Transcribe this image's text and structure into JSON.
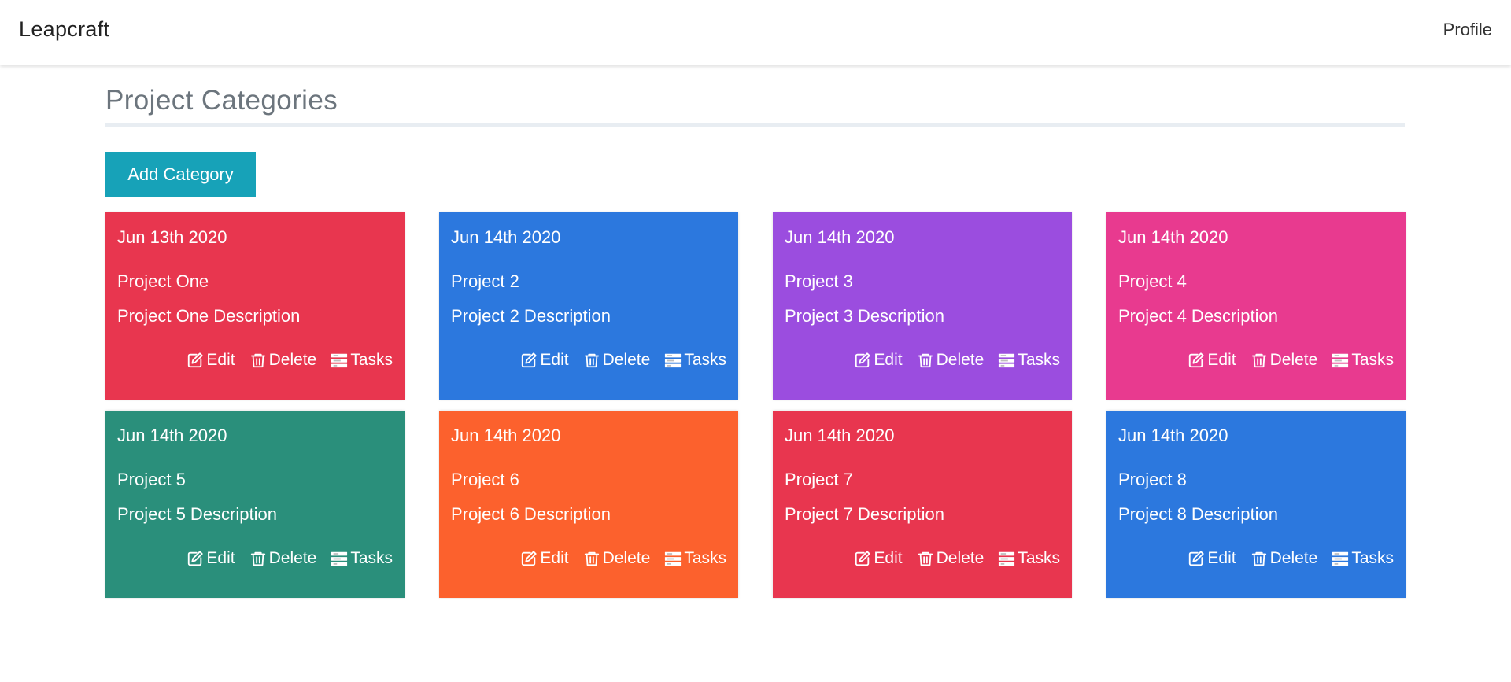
{
  "navbar": {
    "brand": "Leapcraft",
    "profile": "Profile"
  },
  "page": {
    "title": "Project Categories",
    "add_button": "Add Category"
  },
  "actions": {
    "edit": "Edit",
    "delete": "Delete",
    "tasks": "Tasks"
  },
  "categories": [
    {
      "date": "Jun 13th 2020",
      "name": "Project One",
      "description": "Project One Description",
      "color": "#e8364f"
    },
    {
      "date": "Jun 14th 2020",
      "name": "Project 2",
      "description": "Project 2 Description",
      "color": "#2c78de"
    },
    {
      "date": "Jun 14th 2020",
      "name": "Project 3",
      "description": "Project 3 Description",
      "color": "#9b4ddf"
    },
    {
      "date": "Jun 14th 2020",
      "name": "Project 4",
      "description": "Project 4 Description",
      "color": "#e83a8f"
    },
    {
      "date": "Jun 14th 2020",
      "name": "Project 5",
      "description": "Project 5 Description",
      "color": "#2a8f7b"
    },
    {
      "date": "Jun 14th 2020",
      "name": "Project 6",
      "description": "Project 6 Description",
      "color": "#fc612d"
    },
    {
      "date": "Jun 14th 2020",
      "name": "Project 7",
      "description": "Project 7 Description",
      "color": "#e8364f"
    },
    {
      "date": "Jun 14th 2020",
      "name": "Project 8",
      "description": "Project 8 Description",
      "color": "#2c78de"
    }
  ],
  "icons": {
    "edit": "edit-icon",
    "delete": "trash-icon",
    "tasks": "tasks-icon"
  },
  "colors": {
    "accent": "#17a2b8",
    "title": "#6c757d"
  }
}
